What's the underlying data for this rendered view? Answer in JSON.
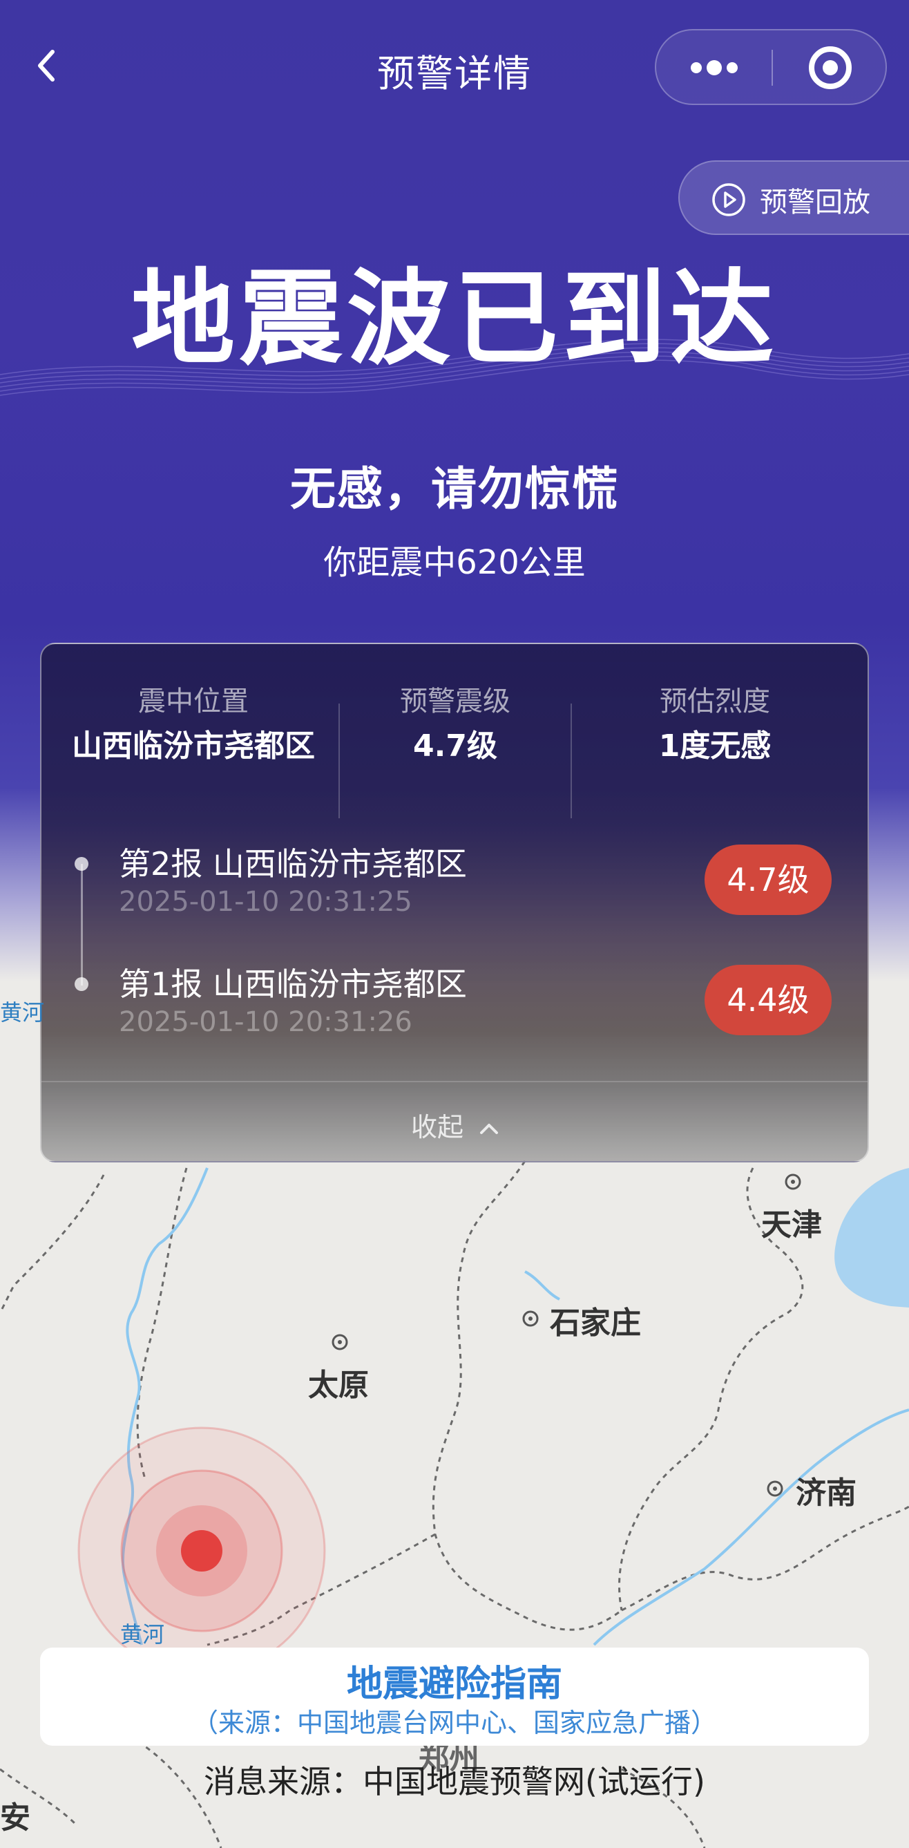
{
  "nav": {
    "title": "预警详情"
  },
  "replay": {
    "label": "预警回放"
  },
  "headline": "地震波已到达",
  "feeling": "无感，请勿惊慌",
  "distance": "你距震中620公里",
  "stats": [
    {
      "key": "震中位置",
      "value": "山西临汾市尧都区"
    },
    {
      "key": "预警震级",
      "value": "4.7级"
    },
    {
      "key": "预估烈度",
      "value": "1度无感"
    }
  ],
  "reports": [
    {
      "title": "第2报 山西临汾市尧都区",
      "time": "2025-01-10 20:31:25",
      "magnitude": "4.7级"
    },
    {
      "title": "第1报 山西临汾市尧都区",
      "time": "2025-01-10 20:31:26",
      "magnitude": "4.4级"
    }
  ],
  "collapse_label": "收起",
  "map": {
    "cities": [
      "天津",
      "石家庄",
      "太原",
      "济南",
      "郑州",
      "安"
    ],
    "rivers": [
      "黄河",
      "黄河"
    ]
  },
  "guide": {
    "title": "地震避险指南",
    "source": "（来源：中国地震台网中心、国家应急广播）"
  },
  "footer_source": "消息来源：中国地震预警网(试运行)",
  "colors": {
    "header": "#4136a6",
    "badge": "#d2473c",
    "link": "#2d7fd6",
    "river": "#8cc8f0"
  },
  "icons": {
    "back": "chevron-left-icon",
    "more": "more-dots-icon",
    "target": "target-icon",
    "replay": "play-circle-icon",
    "collapse": "chevron-up-icon"
  }
}
